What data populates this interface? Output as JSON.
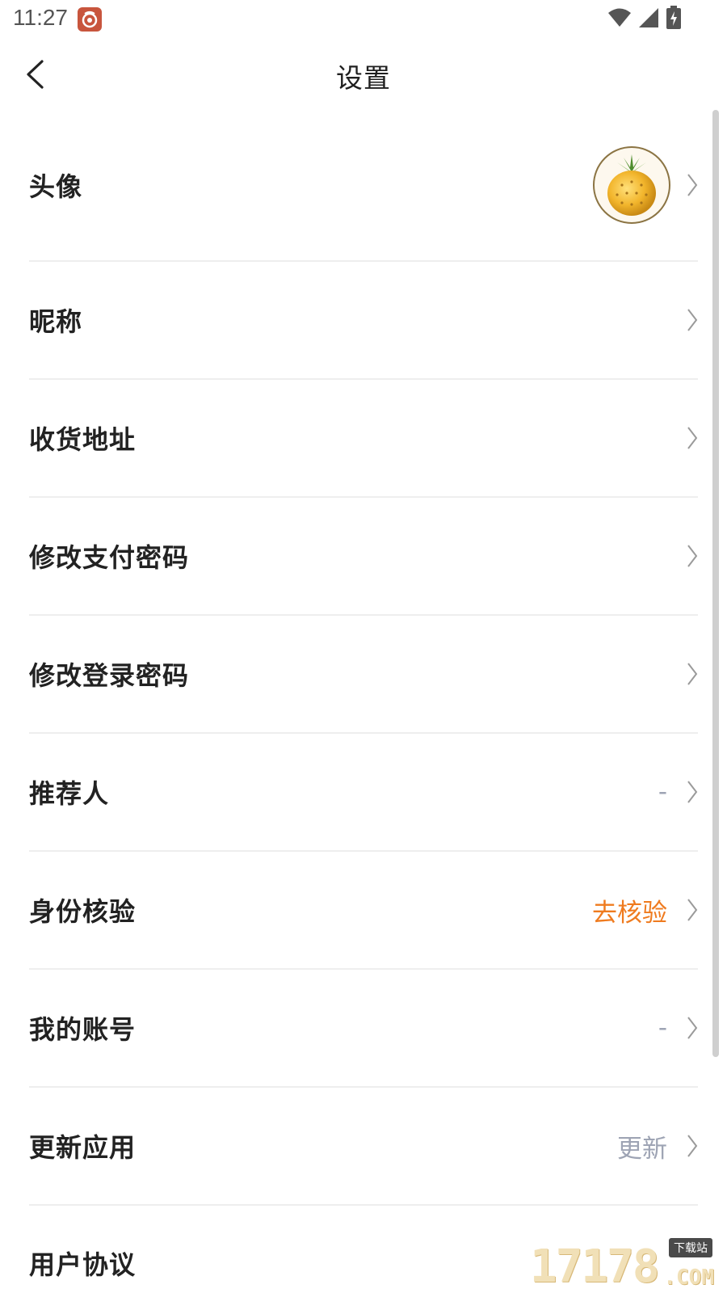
{
  "status_bar": {
    "time": "11:27",
    "app_icon": "notification-app-icon",
    "icons": [
      "wifi-icon",
      "signal-icon",
      "battery-charging-icon"
    ]
  },
  "header": {
    "title": "设置",
    "back_icon": "back-arrow-icon"
  },
  "settings": {
    "items": [
      {
        "label": "头像",
        "value": "",
        "kind": "avatar"
      },
      {
        "label": "昵称",
        "value": ""
      },
      {
        "label": "收货地址",
        "value": ""
      },
      {
        "label": "修改支付密码",
        "value": ""
      },
      {
        "label": "修改登录密码",
        "value": ""
      },
      {
        "label": "推荐人",
        "value": "-"
      },
      {
        "label": "身份核验",
        "value": "去核验"
      },
      {
        "label": "我的账号",
        "value": "-"
      },
      {
        "label": "更新应用",
        "value": "更新"
      },
      {
        "label": "用户协议",
        "value": ""
      }
    ]
  },
  "watermark": {
    "digits": "17178",
    "tag": "下载站",
    "suffix": ".COM"
  },
  "colors": {
    "accent": "#ef7b1f",
    "muted_value": "#9ea4b4",
    "divider": "#eeeeee"
  }
}
